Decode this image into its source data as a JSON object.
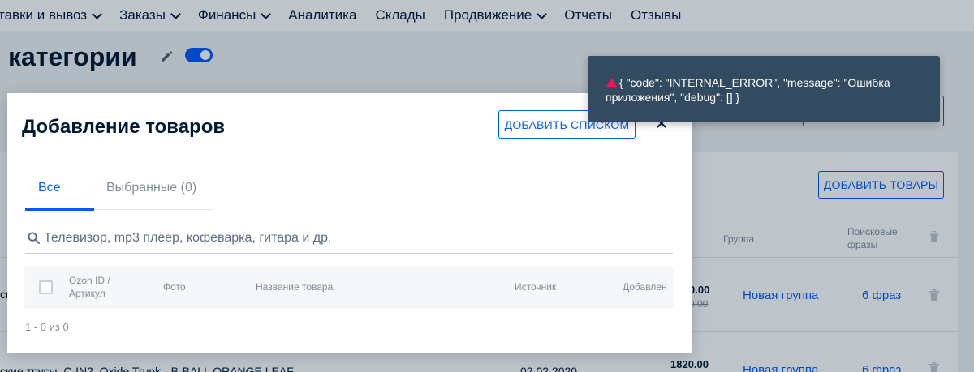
{
  "topnav": {
    "items": [
      {
        "label": "тавки и вывоз",
        "has_menu": true
      },
      {
        "label": "Заказы",
        "has_menu": true
      },
      {
        "label": "Финансы",
        "has_menu": true
      },
      {
        "label": "Аналитика",
        "has_menu": false
      },
      {
        "label": "Склады",
        "has_menu": false
      },
      {
        "label": "Продвижение",
        "has_menu": true
      },
      {
        "label": "Отчеты",
        "has_menu": false
      },
      {
        "label": "Отзывы",
        "has_menu": false
      }
    ]
  },
  "page": {
    "title": "категории",
    "toggle_on": true,
    "add_products_label": "ДОБАВИТЬ ТОВАРЫ",
    "columns": {
      "group": "Группа",
      "search_phrases": "Поисковые\nфразы"
    },
    "rows": [
      {
        "name": "ск",
        "price": "0.00",
        "old_price": "0.00",
        "group": "Новая группа",
        "phrases": "6 фраз"
      },
      {
        "name": "ские трусы. C-IN2. Oxide Trunk - B-BALL ORANGE LEAF",
        "date": "02.02.2020",
        "price": "1820.00",
        "group": "Новая группа",
        "phrases": "6 фраз"
      }
    ]
  },
  "modal": {
    "title": "Добавление товаров",
    "add_list_label": "ДОБАВИТЬ СПИСКОМ",
    "tabs": [
      {
        "label": "Все",
        "active": true
      },
      {
        "label": "Выбранные (0)",
        "active": false
      }
    ],
    "search": {
      "placeholder": "Телевизор, mp3 плеер, кофеварка, гитара и др.",
      "value": ""
    },
    "table": {
      "columns": {
        "id": "Ozon ID /\nАртикул",
        "photo": "Фото",
        "name": "Название товара",
        "source": "Источник",
        "added": "Добавлен"
      }
    },
    "pagination": "1 - 0 из 0"
  },
  "toast": {
    "type": "error",
    "message": "{ \"code\": \"INTERNAL_ERROR\", \"message\": \"Ошибка приложения\", \"debug\": [] }"
  },
  "colors": {
    "accent": "#005bff",
    "text": "#001a34",
    "muted": "#808d9a",
    "toast_bg": "#334b61",
    "error_icon": "#f91155"
  }
}
